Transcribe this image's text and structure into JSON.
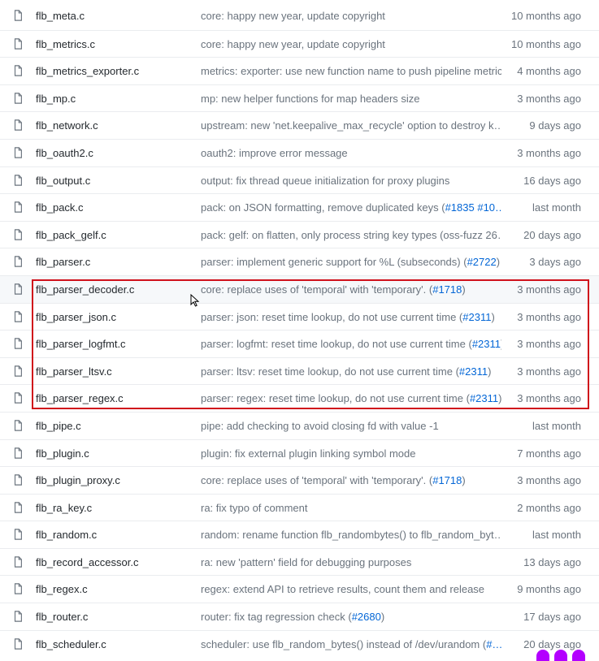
{
  "files": [
    {
      "name": "flb_meta.c",
      "message": "core: happy new year, update copyright",
      "age": "10 months ago"
    },
    {
      "name": "flb_metrics.c",
      "message": "core: happy new year, update copyright",
      "age": "10 months ago"
    },
    {
      "name": "flb_metrics_exporter.c",
      "message": "metrics: exporter: use new function name to push pipeline metrics",
      "age": "4 months ago"
    },
    {
      "name": "flb_mp.c",
      "message": "mp: new helper functions for map headers size",
      "age": "3 months ago"
    },
    {
      "name": "flb_network.c",
      "message": "upstream: new 'net.keepalive_max_recycle' option to destroy k…",
      "age": "9 days ago"
    },
    {
      "name": "flb_oauth2.c",
      "message": "oauth2: improve error message",
      "age": "3 months ago"
    },
    {
      "name": "flb_output.c",
      "message": "output: fix thread queue initialization for proxy plugins",
      "age": "16 days ago"
    },
    {
      "name": "flb_pack.c",
      "message": "pack: on JSON formatting, remove duplicated keys (",
      "pr": "#1835 #10…",
      "message_after": "",
      "age": "last month"
    },
    {
      "name": "flb_pack_gelf.c",
      "message": "pack: gelf: on flatten, only process string key types (oss-fuzz 26…",
      "age": "20 days ago"
    },
    {
      "name": "flb_parser.c",
      "message": "parser: implement generic support for %L (subseconds) (",
      "pr": "#2722",
      "message_after": ")",
      "age": "3 days ago"
    },
    {
      "name": "flb_parser_decoder.c",
      "message": "core: replace uses of 'temporal' with 'temporary'. (",
      "pr": "#1718",
      "message_after": ")",
      "age": "3 months ago"
    },
    {
      "name": "flb_parser_json.c",
      "message": "parser: json: reset time lookup, do not use current time (",
      "pr": "#2311",
      "message_after": ")",
      "age": "3 months ago"
    },
    {
      "name": "flb_parser_logfmt.c",
      "message": "parser: logfmt: reset time lookup, do not use current time (",
      "pr": "#2311",
      "message_after": ")",
      "age": "3 months ago"
    },
    {
      "name": "flb_parser_ltsv.c",
      "message": "parser: ltsv: reset time lookup, do not use current time (",
      "pr": "#2311",
      "message_after": ")",
      "age": "3 months ago"
    },
    {
      "name": "flb_parser_regex.c",
      "message": "parser: regex: reset time lookup, do not use current time (",
      "pr": "#2311",
      "message_after": ")",
      "age": "3 months ago"
    },
    {
      "name": "flb_pipe.c",
      "message": "pipe: add checking to avoid closing fd with value -1",
      "age": "last month"
    },
    {
      "name": "flb_plugin.c",
      "message": "plugin: fix external plugin linking symbol mode",
      "age": "7 months ago"
    },
    {
      "name": "flb_plugin_proxy.c",
      "message": "core: replace uses of 'temporal' with 'temporary'. (",
      "pr": "#1718",
      "message_after": ")",
      "age": "3 months ago"
    },
    {
      "name": "flb_ra_key.c",
      "message": "ra: fix typo of comment",
      "age": "2 months ago"
    },
    {
      "name": "flb_random.c",
      "message": "random: rename function flb_randombytes() to flb_random_byt…",
      "age": "last month"
    },
    {
      "name": "flb_record_accessor.c",
      "message": "ra: new 'pattern' field for debugging purposes",
      "age": "13 days ago"
    },
    {
      "name": "flb_regex.c",
      "message": "regex: extend API to retrieve results, count them and release",
      "age": "9 months ago"
    },
    {
      "name": "flb_router.c",
      "message": "router: fix tag regression check (",
      "pr": "#2680",
      "message_after": ")",
      "age": "17 days ago"
    },
    {
      "name": "flb_scheduler.c",
      "message": "scheduler: use flb_random_bytes() instead of /dev/urandom (",
      "pr": "#…",
      "message_after": "",
      "age": "20 days ago"
    }
  ],
  "hover_row": 10,
  "highlight_rows": [
    10,
    14
  ],
  "colors": {
    "link": "#0366d6",
    "muted": "#6a737d",
    "highlight_border": "#d0111b",
    "icon": "#6a737d"
  },
  "icon_name": "file-icon"
}
